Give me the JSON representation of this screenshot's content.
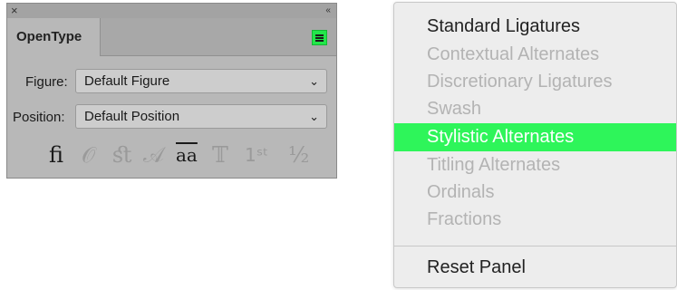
{
  "panel": {
    "close_glyph": "×",
    "collapse_glyph": "‹‹",
    "tab_label": "OpenType",
    "figure_label": "Figure:",
    "figure_value": "Default Figure",
    "position_label": "Position:",
    "position_value": "Default Position",
    "glyph_buttons": [
      {
        "glyph": "ﬁ",
        "name": "standard-ligatures-icon"
      },
      {
        "glyph": "𝒪",
        "name": "swash-icon"
      },
      {
        "glyph": "ﬆ",
        "name": "discretionary-ligatures-icon"
      },
      {
        "glyph": "𝒜",
        "name": "stylistic-alternates-icon"
      },
      {
        "glyph": "aa",
        "name": "contextual-alternates-icon"
      },
      {
        "glyph": "𝕋",
        "name": "titling-alternates-icon"
      },
      {
        "glyph": "1ˢᵗ",
        "name": "ordinals-icon"
      },
      {
        "glyph": "½",
        "name": "fractions-icon"
      }
    ],
    "accent_color": "#22e64a"
  },
  "menu": {
    "items": [
      {
        "label": "Standard Ligatures",
        "state": "enabled"
      },
      {
        "label": "Contextual Alternates",
        "state": "disabled"
      },
      {
        "label": "Discretionary Ligatures",
        "state": "disabled"
      },
      {
        "label": "Swash",
        "state": "disabled"
      },
      {
        "label": "Stylistic Alternates",
        "state": "selected"
      },
      {
        "label": "Titling Alternates",
        "state": "disabled"
      },
      {
        "label": "Ordinals",
        "state": "disabled"
      },
      {
        "label": "Fractions",
        "state": "disabled"
      }
    ],
    "reset_label": "Reset Panel",
    "highlight_color": "#2ef55a"
  }
}
